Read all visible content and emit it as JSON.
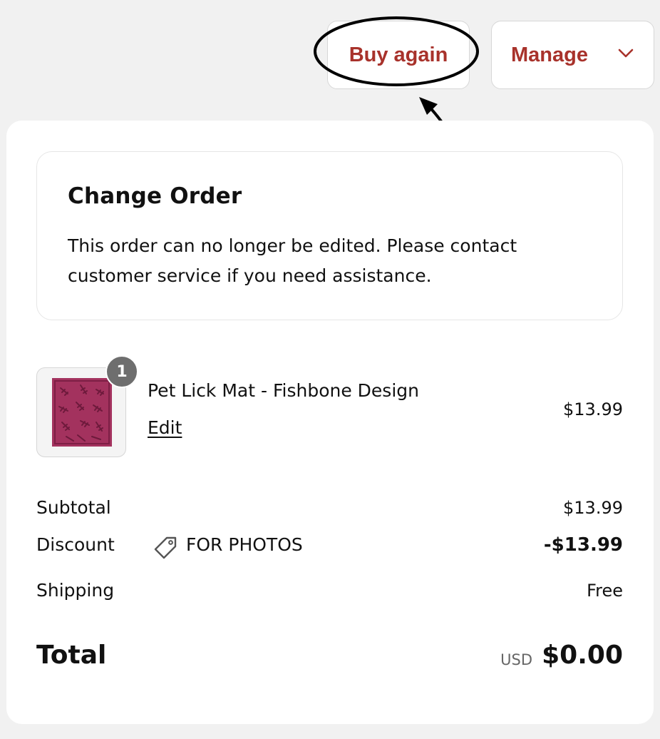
{
  "header": {
    "buy_again_label": "Buy again",
    "manage_label": "Manage"
  },
  "notice": {
    "title": "Change Order",
    "body": "This order can no longer be edited. Please contact customer service if you need assistance."
  },
  "item": {
    "quantity": "1",
    "name": "Pet Lick Mat - Fishbone Design",
    "edit_label": "Edit",
    "price": "$13.99"
  },
  "summary": {
    "subtotal_label": "Subtotal",
    "subtotal_value": "$13.99",
    "discount_label": "Discount",
    "discount_code": "FOR PHOTOS",
    "discount_value": "-$13.99",
    "shipping_label": "Shipping",
    "shipping_value": "Free",
    "total_label": "Total",
    "currency": "USD",
    "total_value": "$0.00"
  },
  "colors": {
    "accent": "#a8322b",
    "background": "#f1f1f1",
    "product": "#a3325e"
  },
  "icons": {
    "manage_dropdown": "chevron-down-icon",
    "discount": "tag-icon",
    "annotation": "arrow-icon"
  }
}
